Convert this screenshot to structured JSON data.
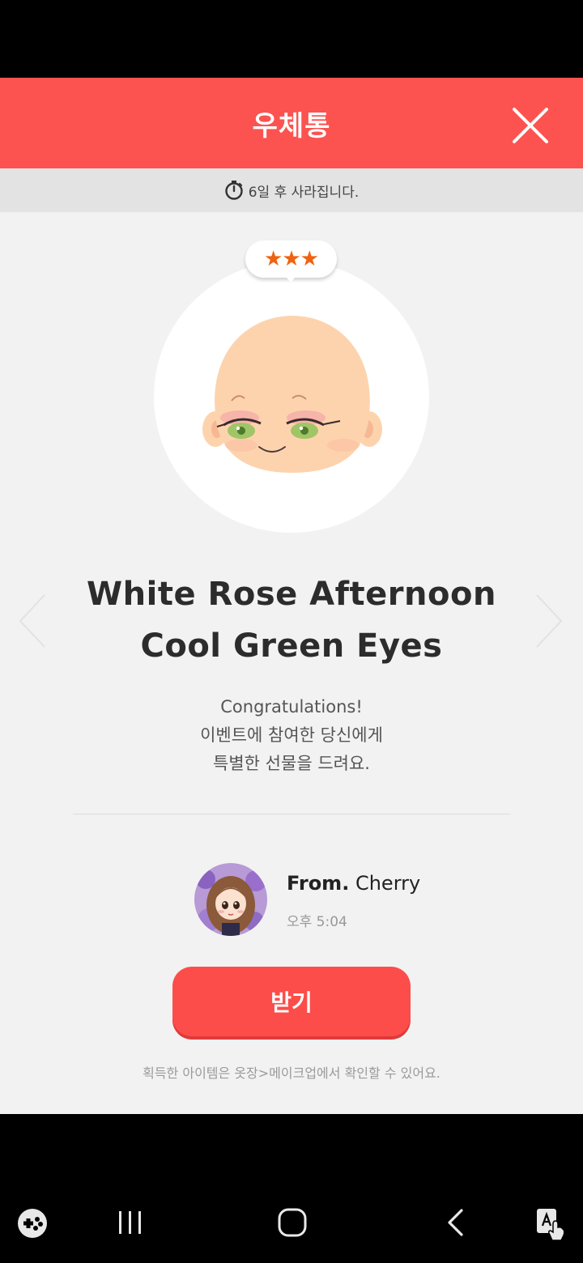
{
  "header": {
    "title": "우체통"
  },
  "timer": {
    "text": "6일 후 사라집니다."
  },
  "item": {
    "rating": "★★★",
    "title": "White Rose Afternoon Cool Green Eyes"
  },
  "message": {
    "line1": "Congratulations!",
    "line2": "이벤트에 참여한 당신에게",
    "line3": "특별한 선물을 드려요."
  },
  "sender": {
    "from_label": "From.",
    "name": "Cherry",
    "time": "오후 5:04"
  },
  "actions": {
    "receive_label": "받기"
  },
  "footnote": "획득한 아이템은 옷장>메이크업에서 확인할 수 있어요.",
  "colors": {
    "accent": "#fc5350",
    "button": "#fc4d4a",
    "star": "#f0620f",
    "background": "#f2f2f2"
  },
  "icons": [
    "close-icon",
    "timer-icon",
    "left-arrow-icon",
    "right-arrow-icon",
    "game-tools-icon",
    "recent-apps-icon",
    "home-icon",
    "back-icon",
    "screen-touch-icon"
  ]
}
